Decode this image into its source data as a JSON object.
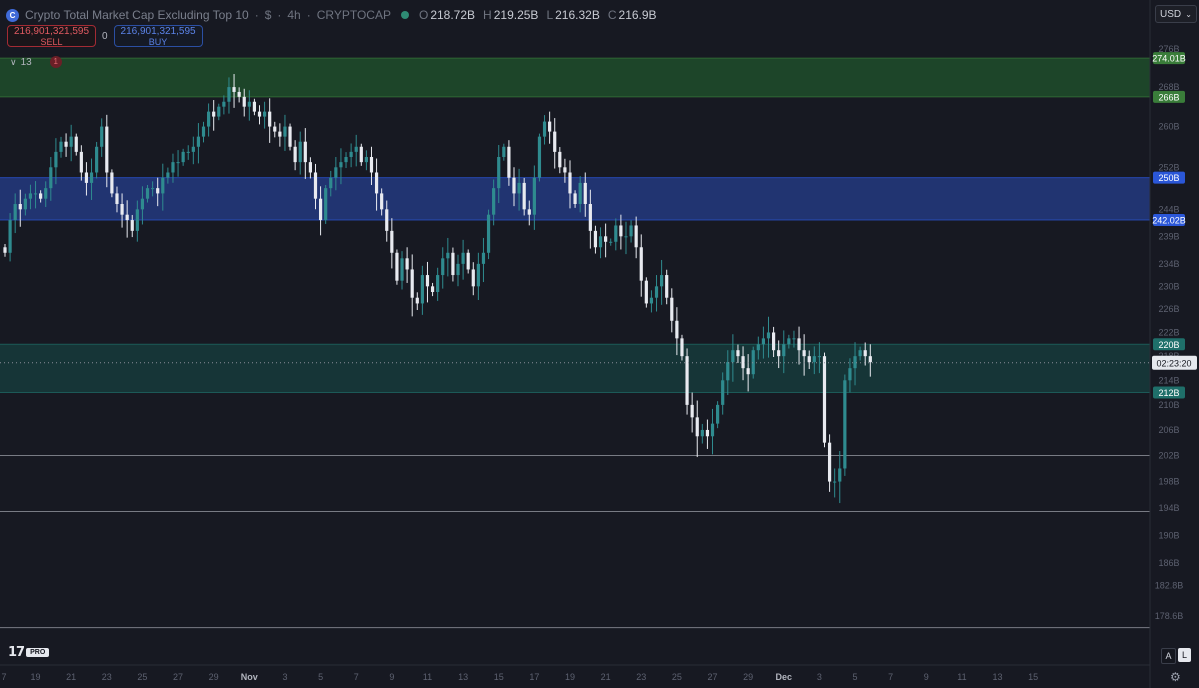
{
  "header": {
    "symbol_icon": "C",
    "title": "Crypto Total Market Cap Excluding Top 10",
    "currency_symbol": "$",
    "interval": "4h",
    "source": "CRYPTOCAP",
    "sep": "·",
    "status_color": "#2f8b74",
    "ohlc": {
      "o_key": "O",
      "o": "218.72B",
      "h_key": "H",
      "h": "219.25B",
      "l_key": "L",
      "l": "216.32B",
      "c_key": "C",
      "c": "216.9B"
    }
  },
  "trade": {
    "sell_price": "216,901,321,595",
    "sell_label": "SELL",
    "spread": "0",
    "buy_price": "216,901,321,595",
    "buy_label": "BUY"
  },
  "indicators": {
    "chevron": "∨",
    "count": "13",
    "alert_count": "1"
  },
  "currency": {
    "label": "USD",
    "caret": "⌄"
  },
  "logo": {
    "mark": "17",
    "pro": "PRO"
  },
  "scale_buttons": {
    "auto": "A",
    "log": "L"
  },
  "icons": {
    "settings": "⚙"
  },
  "colors": {
    "bull": "#2f8b8f",
    "bear": "#e8eaf0",
    "zone_green": "#1f4d2a",
    "zone_blue": "#23397f",
    "zone_teal": "#16383a",
    "label_green": "#3a7d3a",
    "label_blue": "#2b57d8",
    "label_teal": "#1f6f6a"
  },
  "chart_data": {
    "type": "candlestick",
    "title": "",
    "xlabel": "",
    "ylabel": "",
    "y_scale": "log",
    "ylim": [
      172,
      280
    ],
    "price_ticks": [
      "276B",
      "268B",
      "260B",
      "252B",
      "244B",
      "239B",
      "234B",
      "230B",
      "226B",
      "222B",
      "218B",
      "214B",
      "210B",
      "206B",
      "202B",
      "198B",
      "194B",
      "190B",
      "186B",
      "182.8B",
      "178.6B"
    ],
    "price_tick_values": [
      276,
      268,
      260,
      252,
      244,
      239,
      234,
      230,
      226,
      222,
      218,
      214,
      210,
      206,
      202,
      198,
      194,
      190,
      186,
      182.8,
      178.6
    ],
    "time_ticks": [
      "7",
      "19",
      "21",
      "23",
      "25",
      "27",
      "29",
      "Nov",
      "3",
      "5",
      "7",
      "9",
      "11",
      "13",
      "15",
      "17",
      "19",
      "21",
      "23",
      "25",
      "27",
      "29",
      "Dec",
      "3",
      "5",
      "7",
      "9",
      "11",
      "13",
      "15"
    ],
    "time_tick_bar_index": [
      -1,
      6,
      13,
      20,
      27,
      34,
      41,
      48,
      55,
      62,
      69,
      76,
      83,
      90,
      97,
      104,
      111,
      118,
      125,
      132,
      139,
      146,
      153,
      160,
      167,
      174,
      181,
      188,
      195,
      202
    ],
    "zones": [
      {
        "from": 266,
        "to": 274.01,
        "color": "green",
        "labels": [
          "274.01B",
          "266B"
        ]
      },
      {
        "from": 242.02,
        "to": 250,
        "color": "blue",
        "labels": [
          "250B",
          "242.02B"
        ]
      },
      {
        "from": 212,
        "to": 220,
        "color": "teal",
        "labels": [
          "220B",
          "212B"
        ]
      }
    ],
    "horizontal_lines": [
      202,
      193.5,
      177
    ],
    "last_price": 216.9,
    "countdown": "02:23:20",
    "bar_count": 167,
    "closes": [
      236,
      242,
      245,
      244,
      246,
      247,
      247,
      246,
      248,
      252,
      255,
      257,
      256,
      258,
      255,
      251,
      249,
      251,
      256,
      260,
      251,
      247,
      245,
      243,
      242,
      240,
      244,
      246,
      248,
      248,
      247,
      250,
      251,
      253,
      253,
      255,
      255,
      256,
      258,
      260,
      263,
      262,
      264,
      265,
      268,
      267,
      266,
      264,
      265,
      263,
      262,
      263,
      260,
      259,
      258,
      260,
      256,
      253,
      257,
      253,
      251,
      246,
      242,
      248,
      250,
      252,
      253,
      254,
      255,
      256,
      253,
      254,
      251,
      247,
      244,
      240,
      236,
      231,
      235,
      233,
      228,
      227,
      232,
      230,
      229,
      232,
      235,
      236,
      232,
      234,
      236,
      233,
      230,
      234,
      236,
      243,
      248,
      254,
      256,
      250,
      247,
      249,
      244,
      243,
      250,
      258,
      261,
      259,
      255,
      252,
      251,
      247,
      245,
      249,
      245,
      240,
      237,
      239,
      238,
      238,
      241,
      239,
      239,
      241,
      237,
      231,
      227,
      228,
      230,
      232,
      228,
      224,
      221,
      218,
      210,
      208,
      205,
      206,
      205,
      207,
      210,
      214,
      217,
      219,
      218,
      216,
      215,
      219,
      220,
      221,
      222,
      219,
      218,
      220,
      221,
      221,
      219,
      218,
      217,
      218,
      218,
      204,
      198,
      198,
      200,
      214,
      216,
      218,
      219,
      218,
      217
    ]
  }
}
